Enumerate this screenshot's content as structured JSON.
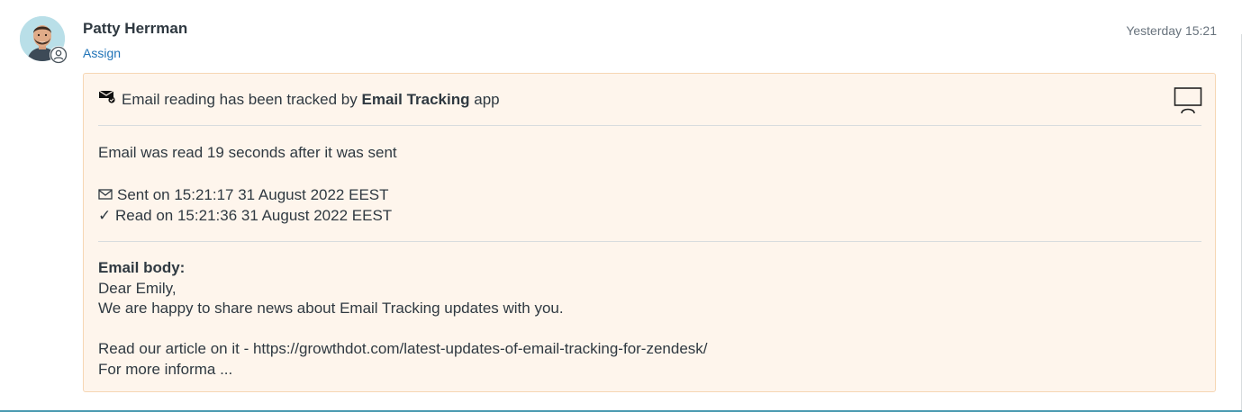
{
  "comment": {
    "author": "Patty Herrman",
    "assign_label": "Assign",
    "timestamp": "Yesterday 15:21"
  },
  "tracking_card": {
    "header_prefix": "Email reading has been tracked by",
    "header_app": "Email Tracking",
    "header_suffix": "app",
    "read_after": "Email was read 19 seconds after it was sent",
    "sent_text": "Sent on 15:21:17 31 August 2022 EEST",
    "read_check": "✓",
    "read_text": "Read on 15:21:36 31 August 2022 EEST",
    "body_label": "Email body:",
    "body_lines": [
      "Dear Emily,",
      "We are happy to share news about Email Tracking updates with you.",
      "Read our article on it - https://growthdot.com/latest-updates-of-email-tracking-for-zendesk/",
      "For more informa ..."
    ]
  },
  "icons": {
    "avatar": "avatar-photo",
    "avatar_badge": "user-icon",
    "header_icon": "envelope-check-icon",
    "sent_icon": "envelope-icon",
    "screen_icon": "monitor-icon"
  },
  "colors": {
    "link": "#1f73b7",
    "card_background": "#fef5ec",
    "card_border": "#f6d7b4",
    "text": "#2f3941",
    "muted": "#68737d"
  }
}
